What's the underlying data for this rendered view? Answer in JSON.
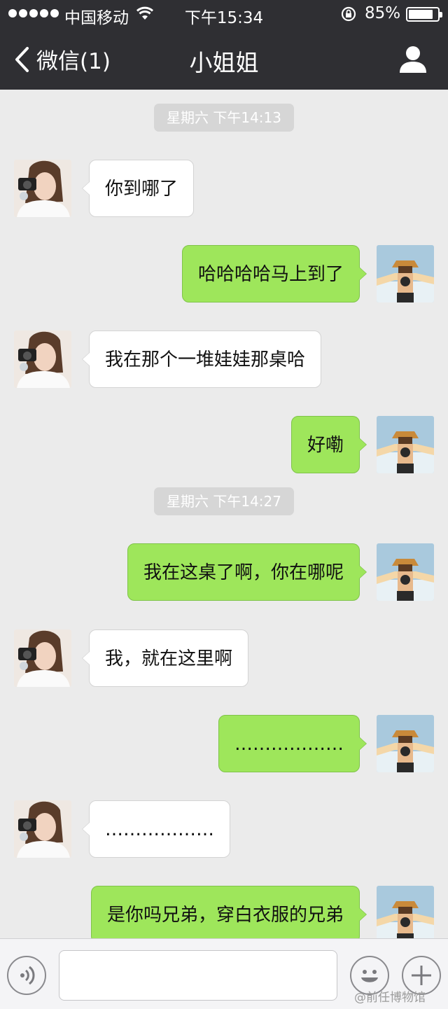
{
  "status_bar": {
    "carrier": "中国移动",
    "time": "下午15:34",
    "battery_percent": "85%",
    "battery_level": 0.85,
    "signal_icon": "signal-dots-icon",
    "wifi_icon": "wifi-icon",
    "lock_icon": "rotation-lock-icon"
  },
  "nav": {
    "back_label": "微信(1)",
    "title": "小姐姐",
    "back_icon": "chevron-left-icon",
    "profile_icon": "person-icon"
  },
  "chat": {
    "timestamps": [
      "星期六 下午14:13",
      "星期六 下午14:27"
    ],
    "messages": [
      {
        "from": "her",
        "text": "你到哪了"
      },
      {
        "from": "me",
        "text": "哈哈哈哈马上到了"
      },
      {
        "from": "her",
        "text": "我在那个一堆娃娃那桌哈"
      },
      {
        "from": "me",
        "text": "好嘞"
      },
      {
        "from": "me",
        "text": "我在这桌了啊，你在哪呢"
      },
      {
        "from": "her",
        "text": "我，就在这里啊"
      },
      {
        "from": "me",
        "text": "………………"
      },
      {
        "from": "her",
        "text": "………………"
      },
      {
        "from": "me",
        "text": "是你吗兄弟，穿白衣服的兄弟"
      }
    ]
  },
  "input_bar": {
    "text_value": "",
    "voice_icon": "voice-icon",
    "emoji_icon": "emoji-icon",
    "plus_icon": "plus-icon"
  },
  "watermark": "@前任博物馆",
  "colors": {
    "bar_bg": "#2f2f33",
    "chat_bg": "#ebebeb",
    "outgoing_bubble": "#9ee65b",
    "incoming_bubble": "#ffffff",
    "timestamp_bg": "#d6d6d6"
  }
}
